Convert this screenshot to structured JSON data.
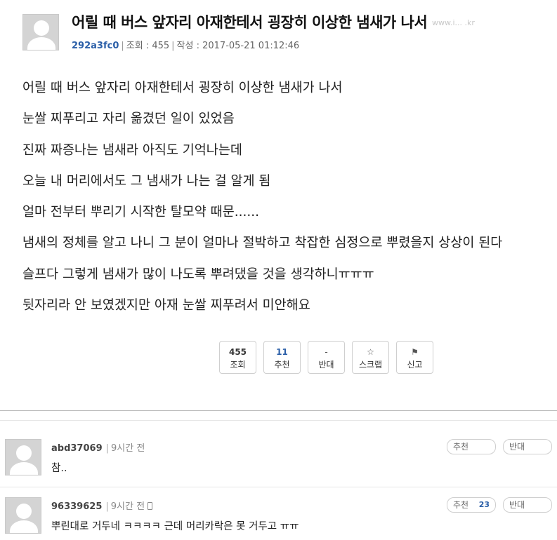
{
  "post": {
    "title": "어릴 때 버스 앞자리 아재한테서 굉장히 이상한 냄새가 나서",
    "author": "292a3fc0",
    "views_label": "조회 : 455",
    "date_label": "작성 : 2017-05-21 01:12:46",
    "body": [
      "어릴 때 버스 앞자리 아재한테서 굉장히 이상한 냄새가 나서",
      "눈쌀 찌푸리고 자리 옮겼던 일이 있었음",
      "진짜 짜증나는 냄새라 아직도 기억나는데",
      "오늘 내 머리에서도 그 냄새가 나는 걸 알게 됨",
      "얼마 전부터 뿌리기 시작한 탈모약 때문......",
      "냄새의 정체를 알고 나니 그 분이 얼마나 절박하고 착잡한 심정으로 뿌렸을지 상상이 된다",
      "슬프다 그렇게 냄새가 많이 나도록 뿌려댔을 것을 생각하니ㅠㅠㅠ",
      "뒷자리라 안 보였겠지만 아재 눈쌀 찌푸려서 미안해요"
    ],
    "watermark": "www.i... .kr"
  },
  "vote_buttons": {
    "views": {
      "value": "455",
      "label": "조회"
    },
    "recommend": {
      "value": "11",
      "label": "추천"
    },
    "oppose": {
      "value": "-",
      "label": "반대"
    },
    "scrap": {
      "label": "스크랩"
    },
    "report": {
      "label": "신고"
    }
  },
  "comments": [
    {
      "author": "abd37069",
      "time": "9시간 전",
      "text": "참..",
      "up_label": "추천",
      "up_count": "",
      "down_label": "반대"
    },
    {
      "author": "96339625",
      "time": "9시간 전",
      "text": "뿌린대로 거두네 ㅋㅋㅋㅋ 근데 머리카락은 못 거두고 ㅠㅠ",
      "up_label": "추천",
      "up_count": "23",
      "down_label": "반대"
    }
  ],
  "colors": {
    "accent": "#2b5fa8",
    "avatar_bg": "#d4d4d4",
    "border": "#cfcfcf"
  }
}
